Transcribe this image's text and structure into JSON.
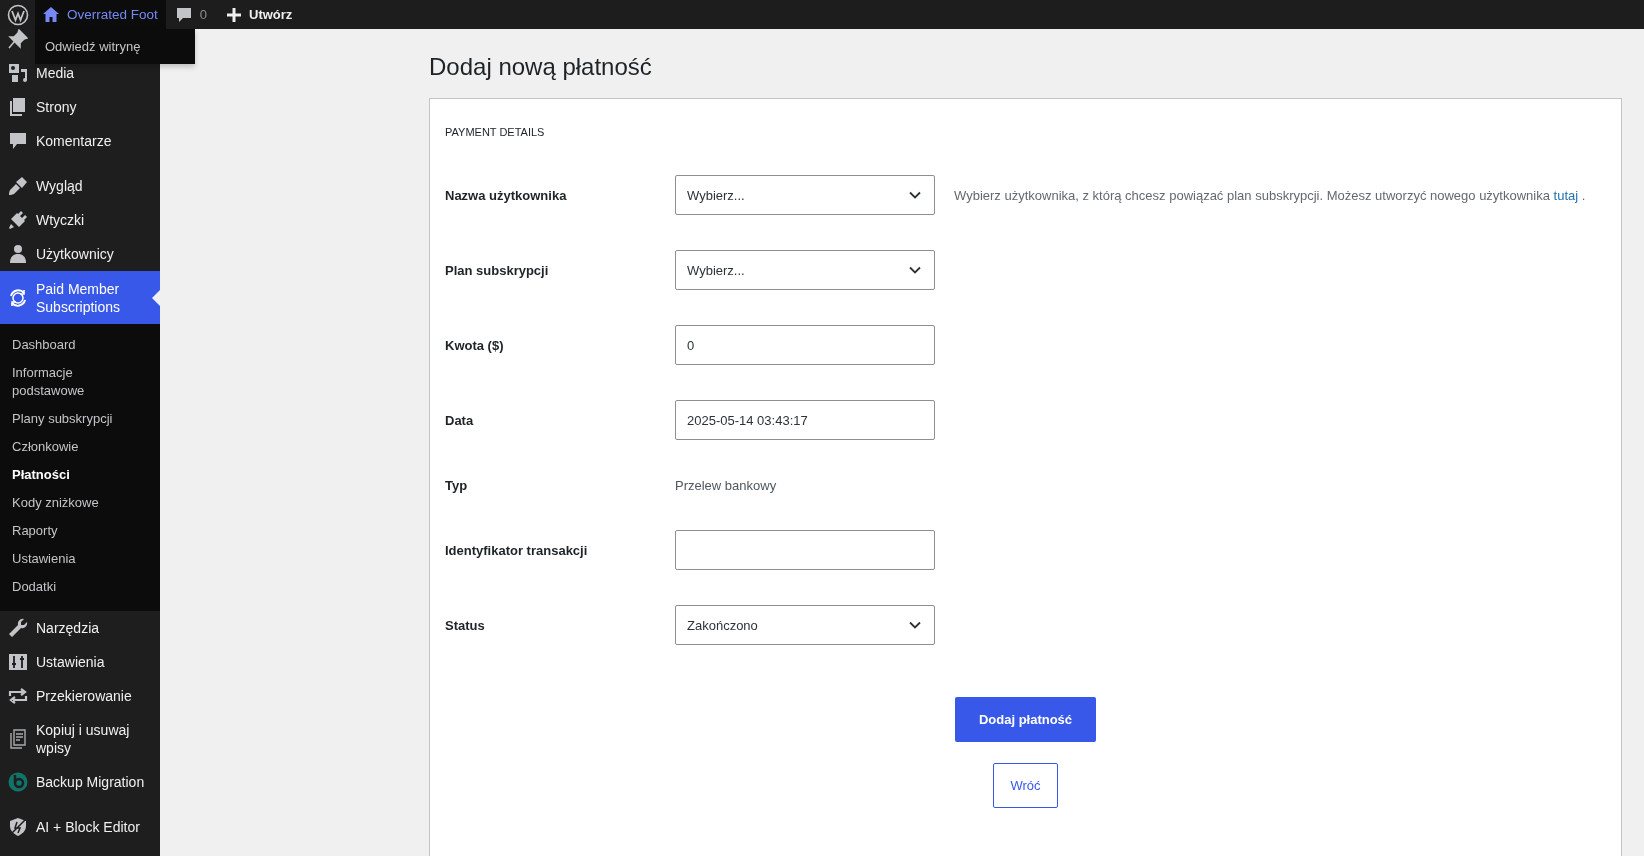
{
  "admin_bar": {
    "site_name": "Overrated Foot",
    "comments_count": "0",
    "new_label": "Utwórz",
    "dropdown": [
      "Odwiedź witrynę"
    ]
  },
  "sidebar": {
    "groups": [
      {
        "items": [
          {
            "current": false
          },
          {
            "label": "Media",
            "current": false
          },
          {
            "label": "Strony",
            "current": false
          },
          {
            "label": "Komentarze",
            "current": false
          }
        ]
      },
      {
        "items": [
          {
            "label": "Wygląd",
            "current": false
          },
          {
            "label": "Wtyczki",
            "current": false
          },
          {
            "label": "Użytkownicy",
            "current": false
          },
          {
            "label": "Paid Member Subscriptions",
            "current": true,
            "submenu": [
              {
                "label": "Dashboard",
                "selected": false
              },
              {
                "label": "Informacje podstawowe",
                "selected": false
              },
              {
                "label": "Plany subskrypcji",
                "selected": false
              },
              {
                "label": "Członkowie",
                "selected": false
              },
              {
                "label": "Płatności",
                "selected": true
              },
              {
                "label": "Kody zniżkowe",
                "selected": false
              },
              {
                "label": "Raporty",
                "selected": false
              },
              {
                "label": "Ustawienia",
                "selected": false
              },
              {
                "label": "Dodatki",
                "selected": false
              }
            ]
          },
          {
            "label": "Narzędzia",
            "current": false
          },
          {
            "label": "Ustawienia",
            "current": false
          },
          {
            "label": "Przekierowanie",
            "current": false
          },
          {
            "label": "Kopiuj i usuwaj wpisy",
            "current": false
          },
          {
            "label": "Backup Migration",
            "current": false
          }
        ]
      },
      {
        "items": [
          {
            "label": "AI + Block Editor",
            "current": false
          }
        ]
      }
    ]
  },
  "page": {
    "title": "Dodaj nową płatność",
    "card": {
      "heading": "PAYMENT DETAILS",
      "rows": [
        {
          "kind": "select",
          "label": "Nazwa użytkownika",
          "value": "Wybierz...",
          "description": {
            "text": "Wybierz użytkownika, z którą chcesz powiązać plan subskrypcji. Możesz utworzyć nowego użytkownika",
            "link": "tutaj",
            "after": "."
          }
        },
        {
          "kind": "select",
          "label": "Plan subskrypcji",
          "value": "Wybierz..."
        },
        {
          "kind": "input",
          "label": "Kwota ($)",
          "value": "0"
        },
        {
          "kind": "input",
          "label": "Data",
          "value": "2025-05-14 03:43:17"
        },
        {
          "kind": "text",
          "label": "Typ",
          "value": "Przelew bankowy"
        },
        {
          "kind": "input",
          "label": "Identyfikator transakcji"
        },
        {
          "kind": "select",
          "label": "Status",
          "value": "Zakończono"
        }
      ],
      "primary_button": "Dodaj płatność",
      "back_button": "Wróć"
    }
  }
}
